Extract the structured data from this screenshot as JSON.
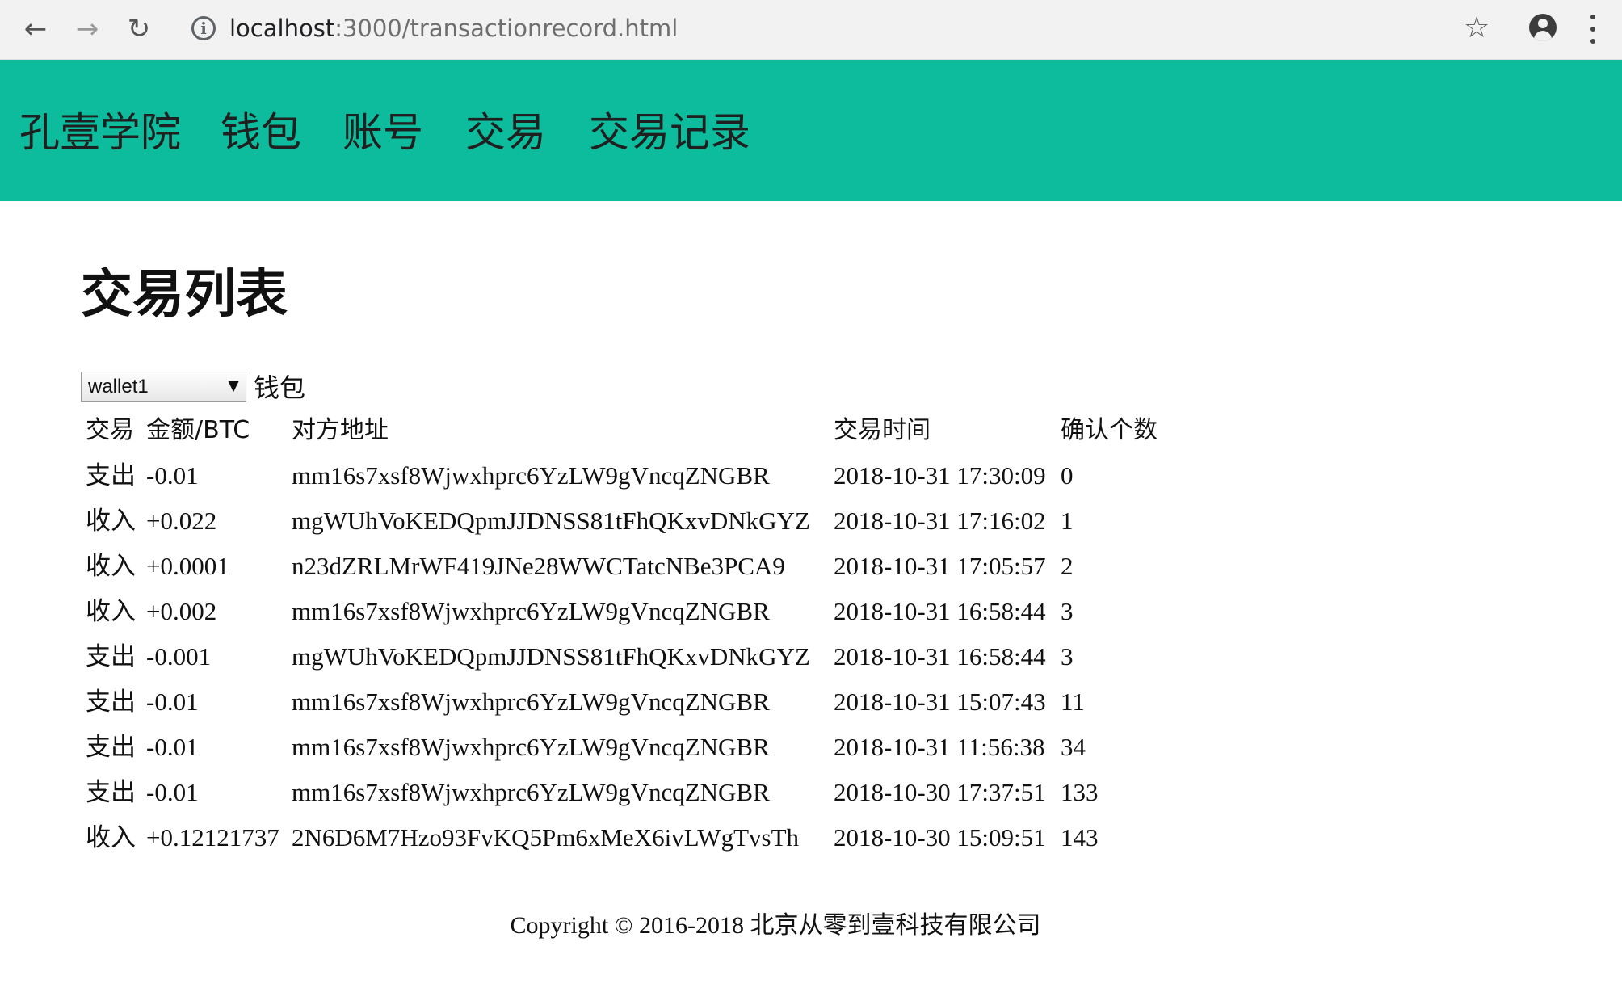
{
  "browser": {
    "back_icon": "arrow-left-icon",
    "forward_icon": "arrow-right-icon",
    "reload_icon": "reload-icon",
    "url_host": "localhost",
    "url_path": ":3000/transactionrecord.html",
    "info_icon": "info-icon",
    "bookmark_icon": "star-icon",
    "account_icon": "account-icon",
    "menu_icon": "kebab-menu-icon"
  },
  "navbar": {
    "background": "#0dbc9c",
    "brand": "孔壹学院",
    "items": [
      {
        "label": "钱包"
      },
      {
        "label": "账号"
      },
      {
        "label": "交易"
      },
      {
        "label": "交易记录"
      }
    ]
  },
  "main": {
    "title": "交易列表",
    "wallet_select": {
      "value": "wallet1"
    },
    "wallet_label": "钱包",
    "table": {
      "headers": [
        "交易",
        "金额/BTC",
        "对方地址",
        "交易时间",
        "确认个数"
      ],
      "rows": [
        {
          "type": "支出",
          "amount": "-0.01",
          "address": "mm16s7xsf8Wjwxhprc6YzLW9gVncqZNGBR",
          "time": "2018-10-31 17:30:09",
          "confirmations": "0"
        },
        {
          "type": "收入",
          "amount": "+0.022",
          "address": "mgWUhVoKEDQpmJJDNSS81tFhQKxvDNkGYZ",
          "time": "2018-10-31 17:16:02",
          "confirmations": "1"
        },
        {
          "type": "收入",
          "amount": "+0.0001",
          "address": "n23dZRLMrWF419JNe28WWCTatcNBe3PCA9",
          "time": "2018-10-31 17:05:57",
          "confirmations": "2"
        },
        {
          "type": "收入",
          "amount": "+0.002",
          "address": "mm16s7xsf8Wjwxhprc6YzLW9gVncqZNGBR",
          "time": "2018-10-31 16:58:44",
          "confirmations": "3"
        },
        {
          "type": "支出",
          "amount": "-0.001",
          "address": "mgWUhVoKEDQpmJJDNSS81tFhQKxvDNkGYZ",
          "time": "2018-10-31 16:58:44",
          "confirmations": "3"
        },
        {
          "type": "支出",
          "amount": "-0.01",
          "address": "mm16s7xsf8Wjwxhprc6YzLW9gVncqZNGBR",
          "time": "2018-10-31 15:07:43",
          "confirmations": "11"
        },
        {
          "type": "支出",
          "amount": "-0.01",
          "address": "mm16s7xsf8Wjwxhprc6YzLW9gVncqZNGBR",
          "time": "2018-10-31 11:56:38",
          "confirmations": "34"
        },
        {
          "type": "支出",
          "amount": "-0.01",
          "address": "mm16s7xsf8Wjwxhprc6YzLW9gVncqZNGBR",
          "time": "2018-10-30 17:37:51",
          "confirmations": "133"
        },
        {
          "type": "收入",
          "amount": "+0.12121737",
          "address": "2N6D6M7Hzo93FvKQ5Pm6xMeX6ivLWgTvsTh",
          "time": "2018-10-30 15:09:51",
          "confirmations": "143"
        }
      ]
    }
  },
  "footer": {
    "copyright": "Copyright © 2016-2018 北京从零到壹科技有限公司"
  }
}
